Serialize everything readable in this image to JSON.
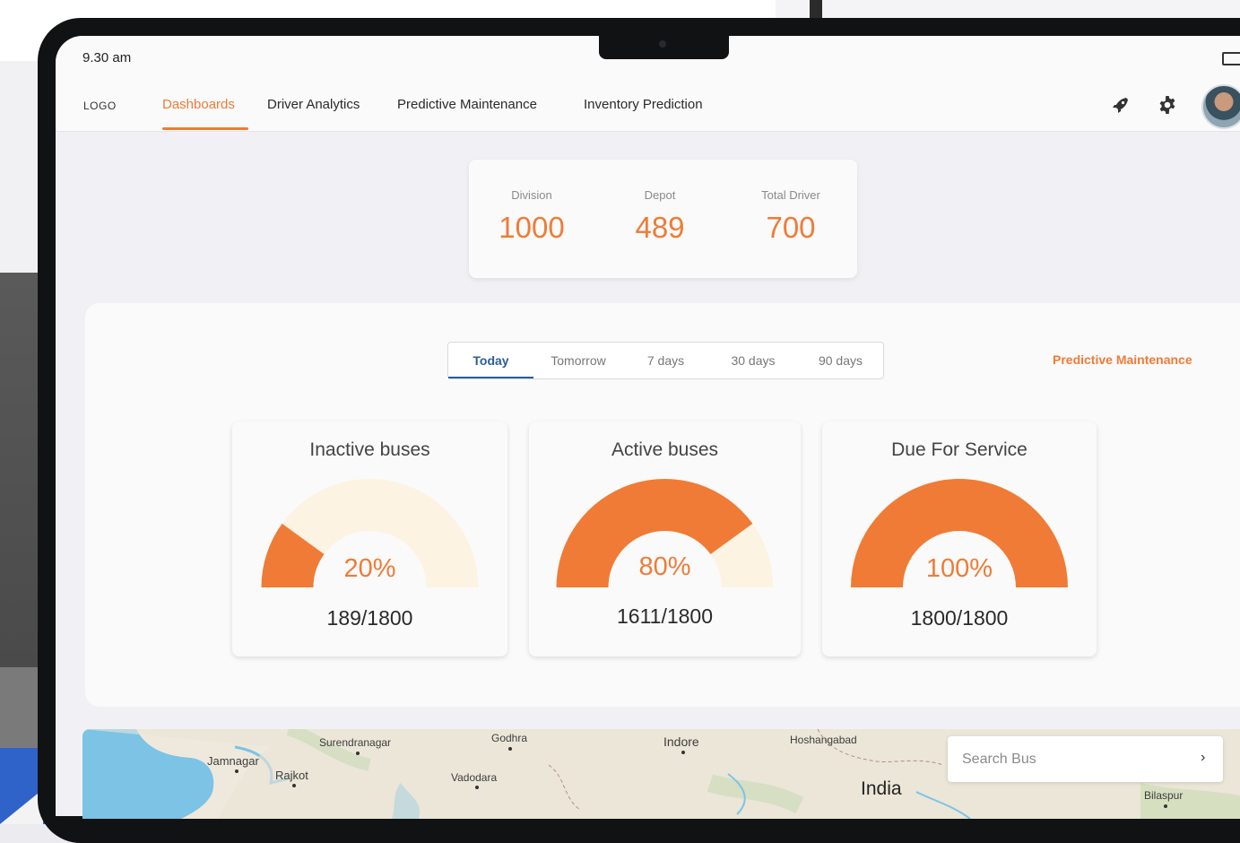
{
  "status": {
    "time": "9.30 am"
  },
  "header": {
    "logo": "LOGO",
    "nav": [
      {
        "label": "Dashboards",
        "active": true
      },
      {
        "label": "Driver Analytics",
        "active": false
      },
      {
        "label": "Predictive Maintenance",
        "active": false
      },
      {
        "label": "Inventory Prediction",
        "active": false
      }
    ],
    "icons": [
      "rocket-icon",
      "gear-icon",
      "avatar"
    ]
  },
  "stats": [
    {
      "label": "Division",
      "value": "1000"
    },
    {
      "label": "Depot",
      "value": "489"
    },
    {
      "label": "Total Driver",
      "value": "700"
    }
  ],
  "tabs": [
    {
      "label": "Today",
      "active": true
    },
    {
      "label": "Tomorrow",
      "active": false
    },
    {
      "label": "7 days",
      "active": false
    },
    {
      "label": "30 days",
      "active": false
    },
    {
      "label": "90 days",
      "active": false
    }
  ],
  "panel_link": "Predictive Maintenance",
  "gauges": [
    {
      "title": "Inactive buses",
      "percent": 20,
      "percent_label": "20%",
      "count": "189/1800"
    },
    {
      "title": "Active buses",
      "percent": 80,
      "percent_label": "80%",
      "count": "1611/1800"
    },
    {
      "title": "Due For Service",
      "percent": 100,
      "percent_label": "100%",
      "count": "1800/1800"
    }
  ],
  "colors": {
    "accent": "#f07b36",
    "gauge_track": "#fcf3e3",
    "tab_active": "#2b5d96"
  },
  "map": {
    "labels": [
      "Surendranagar",
      "Godhra",
      "Indore",
      "Hoshangabad",
      "Jamnagar",
      "Rajkot",
      "Vadodara",
      "Bilaspur"
    ],
    "country": "India"
  },
  "search": {
    "placeholder": "Search Bus",
    "arrow": "›"
  }
}
